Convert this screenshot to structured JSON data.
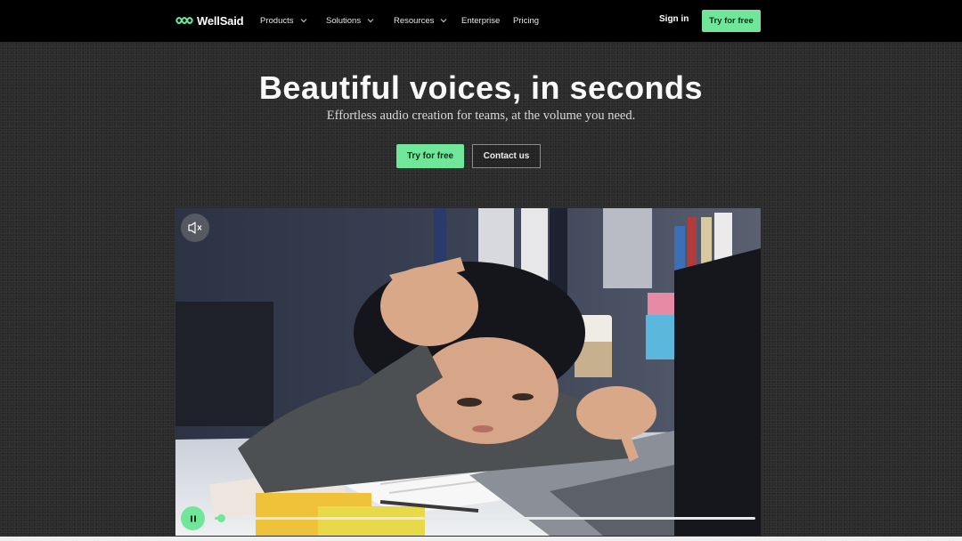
{
  "header": {
    "logo_text": "WellSaid",
    "nav": [
      {
        "label": "Products",
        "has_dropdown": true
      },
      {
        "label": "Solutions",
        "has_dropdown": true
      },
      {
        "label": "Resources",
        "has_dropdown": true
      },
      {
        "label": "Enterprise",
        "has_dropdown": false
      },
      {
        "label": "Pricing",
        "has_dropdown": false
      }
    ],
    "sign_in_label": "Sign in",
    "try_free_label": "Try for free"
  },
  "hero": {
    "title": "Beautiful voices, in seconds",
    "subtitle": "Effortless audio creation for teams, at the volume you need.",
    "primary_cta": "Try for free",
    "secondary_cta": "Contact us"
  },
  "video": {
    "muted": true,
    "playing": true,
    "progress_fraction": 0.012,
    "icons": {
      "mute": "speaker-muted-icon",
      "pause": "pause-icon"
    }
  },
  "colors": {
    "accent": "#6fe69a",
    "header_bg": "#000000",
    "page_bg": "#2b2b2b"
  }
}
